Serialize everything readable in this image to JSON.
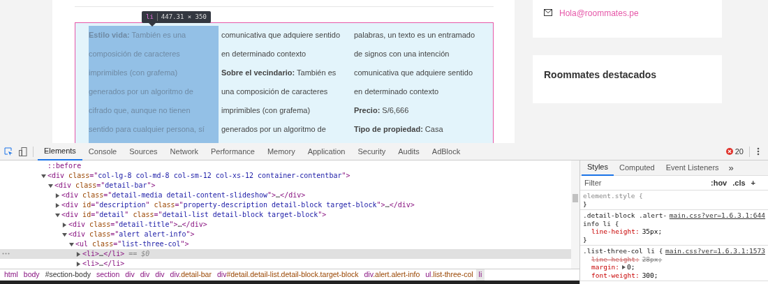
{
  "page": {
    "tooltip": {
      "tag": "li",
      "size": "447.31 × 350"
    },
    "columns": [
      {
        "selected": true,
        "lines": [
          "**Estilo vida:** También es una",
          "composición de caracteres",
          "imprimibles (con grafema)",
          "generados por un algoritmo de",
          "cifrado que, aunque no tienen",
          "sentido para cualquier persona, sí"
        ]
      },
      {
        "selected": false,
        "lines": [
          "comunicativa que adquiere sentido",
          "en determinado contexto",
          "**Sobre el vecindario:** También es",
          "una composición de caracteres",
          "imprimibles (con grafema)",
          "generados por un algoritmo de"
        ]
      },
      {
        "selected": false,
        "lines": [
          "palabras, un texto es un entramado",
          "de signos con una intención",
          "comunicativa que adquiere sentido",
          "en determinado contexto",
          "**Precio:** S/6,666",
          "**Tipo de propiedad:** Casa"
        ]
      }
    ],
    "contact_email": "Hola@roommates.pe",
    "featured_title": "Roommates destacados"
  },
  "devtools": {
    "tabs": [
      {
        "label": "Elements",
        "selected": true
      },
      {
        "label": "Console",
        "selected": false
      },
      {
        "label": "Sources",
        "selected": false
      },
      {
        "label": "Network",
        "selected": false
      },
      {
        "label": "Performance",
        "selected": false
      },
      {
        "label": "Memory",
        "selected": false
      },
      {
        "label": "Application",
        "selected": false
      },
      {
        "label": "Security",
        "selected": false
      },
      {
        "label": "Audits",
        "selected": false
      },
      {
        "label": "AdBlock",
        "selected": false
      }
    ],
    "error_count": "20",
    "tree": [
      {
        "kind": "pseudo",
        "tokens": [
          {
            "kind": "pseudo",
            "text": "::before"
          }
        ]
      },
      {
        "kind": "element",
        "expanded": true,
        "selected": false,
        "tokens": [
          {
            "kind": "tag",
            "text": "<div"
          },
          {
            "kind": "attr",
            "text": " class"
          },
          {
            "kind": "punct",
            "text": "=\""
          },
          {
            "kind": "value",
            "text": "col-lg-8 col-md-8 col-sm-12 col-xs-12 container-contentbar"
          },
          {
            "kind": "punct",
            "text": "\">"
          }
        ],
        "children": [
          {
            "kind": "element",
            "expanded": true,
            "selected": false,
            "tokens": [
              {
                "kind": "tag",
                "text": "<div"
              },
              {
                "kind": "attr",
                "text": " class"
              },
              {
                "kind": "punct",
                "text": "=\""
              },
              {
                "kind": "value",
                "text": "detail-bar"
              },
              {
                "kind": "punct",
                "text": "\">"
              }
            ],
            "children": [
              {
                "kind": "element",
                "expanded": false,
                "selected": false,
                "tokens": [
                  {
                    "kind": "tag",
                    "text": "<div"
                  },
                  {
                    "kind": "attr",
                    "text": " class"
                  },
                  {
                    "kind": "punct",
                    "text": "=\""
                  },
                  {
                    "kind": "value",
                    "text": "detail-media detail-content-slideshow"
                  },
                  {
                    "kind": "punct",
                    "text": "\">"
                  },
                  {
                    "kind": "plain",
                    "text": "…"
                  },
                  {
                    "kind": "tag",
                    "text": "</div>"
                  }
                ]
              },
              {
                "kind": "element",
                "expanded": false,
                "selected": false,
                "tokens": [
                  {
                    "kind": "tag",
                    "text": "<div"
                  },
                  {
                    "kind": "attr",
                    "text": " id"
                  },
                  {
                    "kind": "punct",
                    "text": "=\""
                  },
                  {
                    "kind": "value",
                    "text": "description"
                  },
                  {
                    "kind": "punct",
                    "text": "\""
                  },
                  {
                    "kind": "attr",
                    "text": " class"
                  },
                  {
                    "kind": "punct",
                    "text": "=\""
                  },
                  {
                    "kind": "value",
                    "text": "property-description detail-block target-block"
                  },
                  {
                    "kind": "punct",
                    "text": "\">"
                  },
                  {
                    "kind": "plain",
                    "text": "…"
                  },
                  {
                    "kind": "tag",
                    "text": "</div>"
                  }
                ]
              },
              {
                "kind": "element",
                "expanded": true,
                "selected": false,
                "tokens": [
                  {
                    "kind": "tag",
                    "text": "<div"
                  },
                  {
                    "kind": "attr",
                    "text": " id"
                  },
                  {
                    "kind": "punct",
                    "text": "=\""
                  },
                  {
                    "kind": "value",
                    "text": "detail"
                  },
                  {
                    "kind": "punct",
                    "text": "\""
                  },
                  {
                    "kind": "attr",
                    "text": " class"
                  },
                  {
                    "kind": "punct",
                    "text": "=\""
                  },
                  {
                    "kind": "value",
                    "text": "detail-list detail-block target-block"
                  },
                  {
                    "kind": "punct",
                    "text": "\">"
                  }
                ],
                "children": [
                  {
                    "kind": "element",
                    "expanded": false,
                    "selected": false,
                    "tokens": [
                      {
                        "kind": "tag",
                        "text": "<div"
                      },
                      {
                        "kind": "attr",
                        "text": " class"
                      },
                      {
                        "kind": "punct",
                        "text": "=\""
                      },
                      {
                        "kind": "value",
                        "text": "detail-title"
                      },
                      {
                        "kind": "punct",
                        "text": "\">"
                      },
                      {
                        "kind": "plain",
                        "text": "…"
                      },
                      {
                        "kind": "tag",
                        "text": "</div>"
                      }
                    ]
                  },
                  {
                    "kind": "element",
                    "expanded": true,
                    "selected": false,
                    "tokens": [
                      {
                        "kind": "tag",
                        "text": "<div"
                      },
                      {
                        "kind": "attr",
                        "text": " class"
                      },
                      {
                        "kind": "punct",
                        "text": "=\""
                      },
                      {
                        "kind": "value",
                        "text": "alert alert-info"
                      },
                      {
                        "kind": "punct",
                        "text": "\">"
                      }
                    ],
                    "children": [
                      {
                        "kind": "element",
                        "expanded": true,
                        "selected": false,
                        "tokens": [
                          {
                            "kind": "tag",
                            "text": "<ul"
                          },
                          {
                            "kind": "attr",
                            "text": " class"
                          },
                          {
                            "kind": "punct",
                            "text": "=\""
                          },
                          {
                            "kind": "value",
                            "text": "list-three-col"
                          },
                          {
                            "kind": "punct",
                            "text": "\">"
                          }
                        ],
                        "children": [
                          {
                            "kind": "element",
                            "expanded": false,
                            "selected": true,
                            "tokens": [
                              {
                                "kind": "tag",
                                "text": "<li>"
                              },
                              {
                                "kind": "plain",
                                "text": "…"
                              },
                              {
                                "kind": "tag",
                                "text": "</li>"
                              },
                              {
                                "kind": "marker",
                                "text": " == $0"
                              }
                            ]
                          },
                          {
                            "kind": "element",
                            "expanded": false,
                            "selected": false,
                            "tokens": [
                              {
                                "kind": "tag",
                                "text": "<li>"
                              },
                              {
                                "kind": "plain",
                                "text": "…"
                              },
                              {
                                "kind": "tag",
                                "text": "</li>"
                              }
                            ]
                          }
                        ]
                      }
                    ]
                  }
                ]
              }
            ]
          }
        ]
      }
    ],
    "breadcrumbs": [
      {
        "tag": "html",
        "selected": false
      },
      {
        "tag": "body",
        "selected": false
      },
      {
        "rest": "#section-body",
        "selected": false
      },
      {
        "tag": "section",
        "selected": false
      },
      {
        "tag": "div",
        "selected": false
      },
      {
        "tag": "div",
        "selected": false
      },
      {
        "tag": "div",
        "selected": false
      },
      {
        "tag": "div",
        "rest": ".detail-bar",
        "selected": false
      },
      {
        "tag": "div",
        "rest": "#detail.detail-list.detail-block.target-block",
        "selected": false
      },
      {
        "tag": "div",
        "rest": ".alert.alert-info",
        "selected": false
      },
      {
        "tag": "ul",
        "rest": ".list-three-col",
        "selected": false
      },
      {
        "tag": "li",
        "selected": true
      }
    ],
    "side_tabs": [
      {
        "label": "Styles",
        "selected": true
      },
      {
        "label": "Computed",
        "selected": false
      },
      {
        "label": "Event Listeners",
        "selected": false
      }
    ],
    "side_more": "»",
    "filter": {
      "placeholder": "Filter"
    },
    "filter_buttons": [
      ":hov",
      ".cls",
      "+"
    ],
    "rules": [
      {
        "selector": "element.style {",
        "close": "}"
      },
      {
        "selector": ".detail-block .alert-info li {",
        "source": "main.css?ver=1.6.3.1:644",
        "props": [
          {
            "name": "line-height:",
            "value": "35px;",
            "struck": false,
            "expandable": false
          }
        ],
        "close": "}"
      },
      {
        "selector": ".list-three-col li {",
        "source": "main.css?ver=1.6.3.1:1573",
        "props": [
          {
            "name": "line-height:",
            "value": "28px;",
            "struck": true,
            "expandable": false
          },
          {
            "name": "margin:",
            "value": "0;",
            "struck": false,
            "expandable": true
          },
          {
            "name": "font-weight:",
            "value": "300;",
            "struck": false,
            "expandable": false
          }
        ]
      }
    ]
  }
}
